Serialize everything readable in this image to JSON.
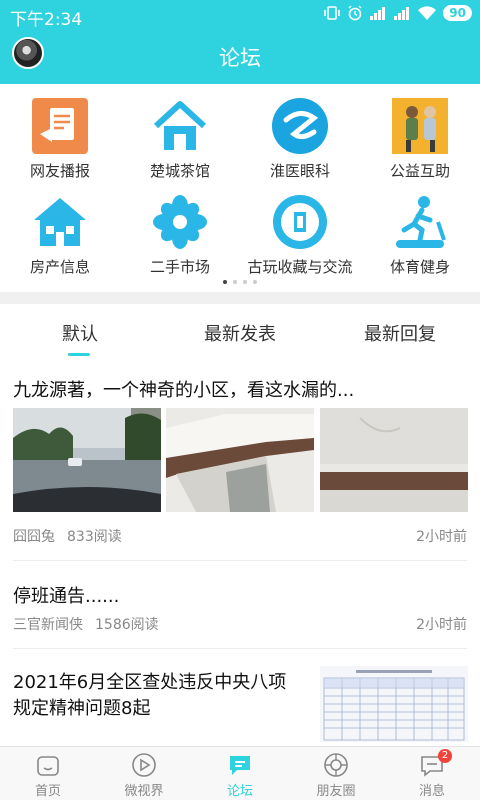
{
  "status_bar": {
    "time": "下午2:34",
    "battery": "90"
  },
  "header": {
    "title": "论坛"
  },
  "grid": [
    {
      "label": "网友播报",
      "icon": "broadcast-icon"
    },
    {
      "label": "楚城茶馆",
      "icon": "house-icon"
    },
    {
      "label": "淮医眼科",
      "icon": "eye-hospital-icon"
    },
    {
      "label": "公益互助",
      "icon": "charity-icon"
    },
    {
      "label": "房产信息",
      "icon": "real-estate-icon"
    },
    {
      "label": "二手市场",
      "icon": "flower-icon"
    },
    {
      "label": "古玩收藏与交流",
      "icon": "coin-icon"
    },
    {
      "label": "体育健身",
      "icon": "treadmill-icon"
    }
  ],
  "tabs": [
    "默认",
    "最新发表",
    "最新回复"
  ],
  "posts": [
    {
      "title": "九龙源著，一个神奇的小区，看这水漏的...",
      "author": "囧囧兔",
      "views": "833阅读",
      "time": "2小时前"
    },
    {
      "title": "停班通告......",
      "author": "三官新闻侠",
      "views": "1586阅读",
      "time": "2小时前"
    },
    {
      "title_line1": "2021年6月全区查处违反中央八项",
      "title_line2": "规定精神问题8起"
    }
  ],
  "nav": [
    {
      "label": "首页",
      "icon": "home-icon"
    },
    {
      "label": "微视界",
      "icon": "play-icon"
    },
    {
      "label": "论坛",
      "icon": "forum-icon"
    },
    {
      "label": "朋友圈",
      "icon": "moments-icon"
    },
    {
      "label": "消息",
      "icon": "message-icon",
      "badge": "2"
    }
  ],
  "colors": {
    "accent": "#2ed3df",
    "badge": "#f0443a"
  }
}
